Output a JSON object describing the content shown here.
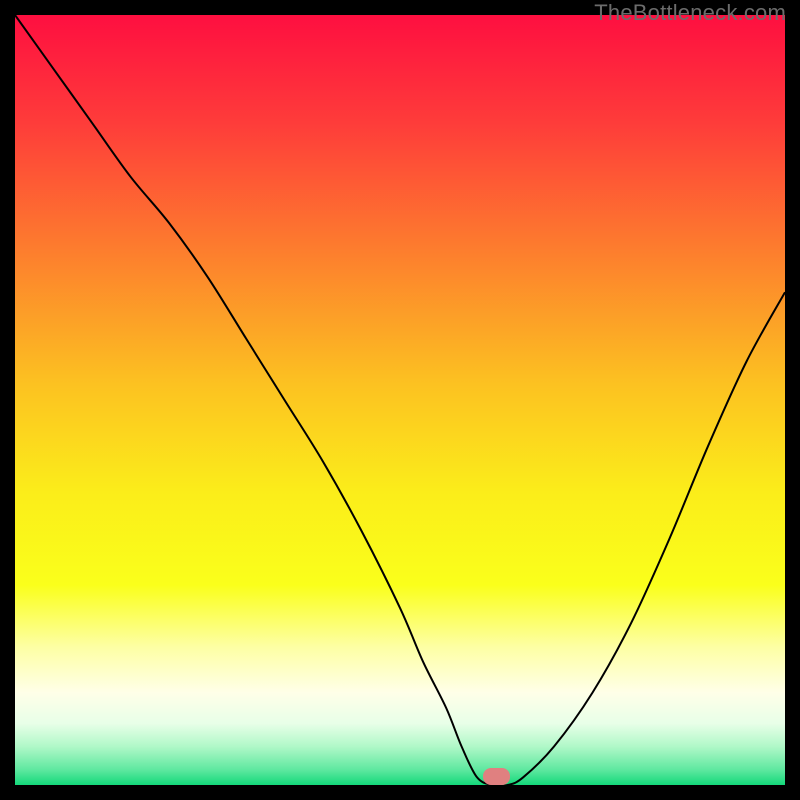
{
  "watermark": "TheBottleneck.com",
  "colors": {
    "gradient_stops": [
      {
        "pct": 0,
        "color": "#fe0f40"
      },
      {
        "pct": 14,
        "color": "#fe3c3a"
      },
      {
        "pct": 30,
        "color": "#fd7b2e"
      },
      {
        "pct": 48,
        "color": "#fcc221"
      },
      {
        "pct": 62,
        "color": "#fbed1a"
      },
      {
        "pct": 74,
        "color": "#faff1b"
      },
      {
        "pct": 82,
        "color": "#fdffa3"
      },
      {
        "pct": 88,
        "color": "#ffffe8"
      },
      {
        "pct": 92,
        "color": "#e8ffe8"
      },
      {
        "pct": 95,
        "color": "#b0f8c8"
      },
      {
        "pct": 98,
        "color": "#5fe8a0"
      },
      {
        "pct": 100,
        "color": "#14d87a"
      }
    ],
    "curve": "#000000",
    "marker": "#e08080",
    "frame": "#000000"
  },
  "chart_data": {
    "type": "line",
    "title": "",
    "xlabel": "",
    "ylabel": "",
    "xlim": [
      0,
      100
    ],
    "ylim": [
      0,
      100
    ],
    "series": [
      {
        "name": "bottleneck-curve",
        "x": [
          0,
          5,
          10,
          15,
          20,
          25,
          30,
          35,
          40,
          45,
          50,
          53,
          56,
          58,
          60,
          62,
          64,
          66,
          70,
          75,
          80,
          85,
          90,
          95,
          100
        ],
        "y": [
          100,
          93,
          86,
          79,
          73,
          66,
          58,
          50,
          42,
          33,
          23,
          16,
          10,
          5,
          1,
          0,
          0,
          1,
          5,
          12,
          21,
          32,
          44,
          55,
          64
        ]
      }
    ],
    "marker": {
      "x": 62.5,
      "y": 0,
      "w": 3.5,
      "h": 2.2
    }
  }
}
